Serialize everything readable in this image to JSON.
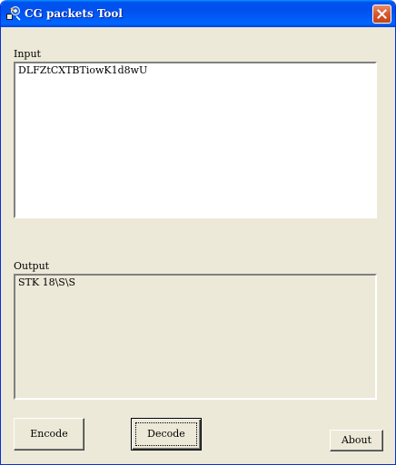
{
  "window": {
    "title": "CG packets Tool",
    "icon": "app-icon",
    "close_icon": "close-icon"
  },
  "input": {
    "label": "Input",
    "value": "DLFZtCXTBTiowK1d8wU"
  },
  "output": {
    "label": "Output",
    "value": "STK 18\\S\\S"
  },
  "buttons": {
    "encode": "Encode",
    "decode": "Decode",
    "about": "About"
  },
  "colors": {
    "titlebar": "#0054e3",
    "window_bg": "#ece9d8",
    "close_button": "#d6582e"
  }
}
